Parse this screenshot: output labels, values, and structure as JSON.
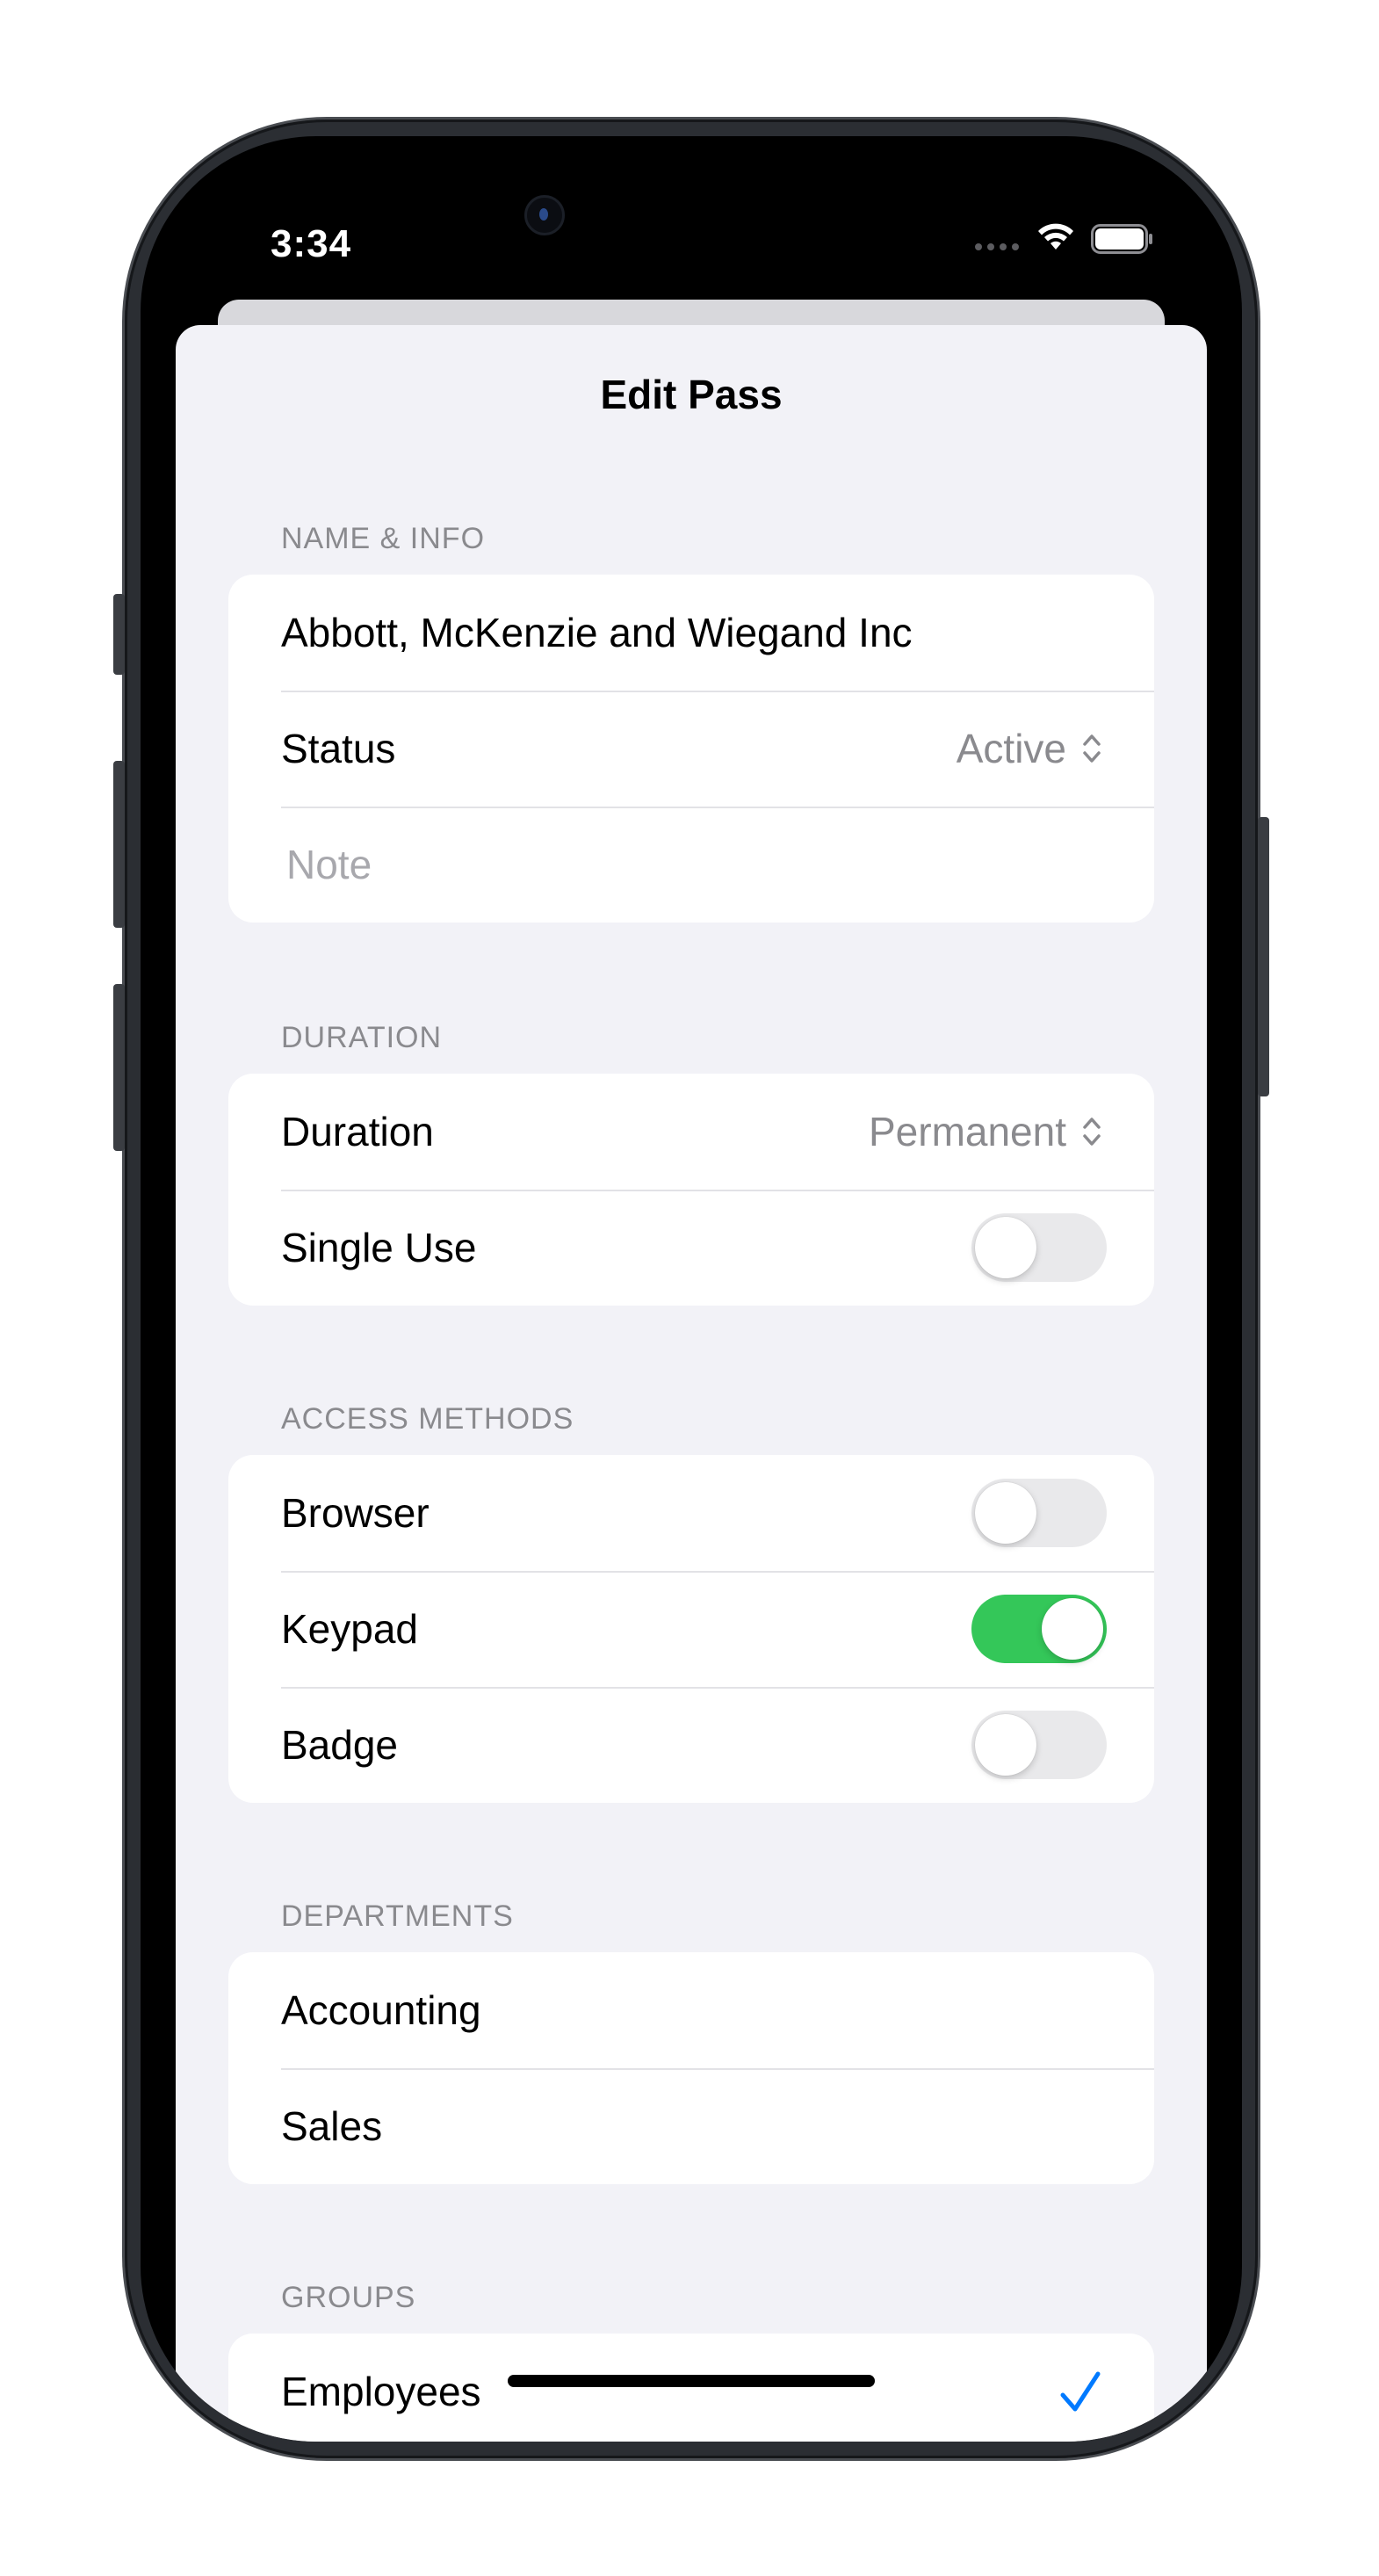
{
  "status_bar": {
    "time": "3:34"
  },
  "sheet": {
    "title": "Edit Pass"
  },
  "name_info": {
    "header": "NAME & INFO",
    "name_value": "Abbott, McKenzie and Wiegand Inc",
    "status_label": "Status",
    "status_value": "Active",
    "note_placeholder": "Note"
  },
  "duration": {
    "header": "DURATION",
    "duration_label": "Duration",
    "duration_value": "Permanent",
    "single_use_label": "Single Use",
    "single_use_on": false
  },
  "access_methods": {
    "header": "ACCESS METHODS",
    "items": [
      {
        "label": "Browser",
        "on": false
      },
      {
        "label": "Keypad",
        "on": true
      },
      {
        "label": "Badge",
        "on": false
      }
    ]
  },
  "departments": {
    "header": "DEPARTMENTS",
    "items": [
      "Accounting",
      "Sales"
    ]
  },
  "groups": {
    "header": "GROUPS",
    "items": [
      {
        "label": "Employees",
        "checked": true
      }
    ]
  },
  "colors": {
    "accent": "#007aff",
    "toggle_on": "#34c759",
    "background": "#f2f2f7",
    "secondary_text": "#8a8a8e"
  }
}
